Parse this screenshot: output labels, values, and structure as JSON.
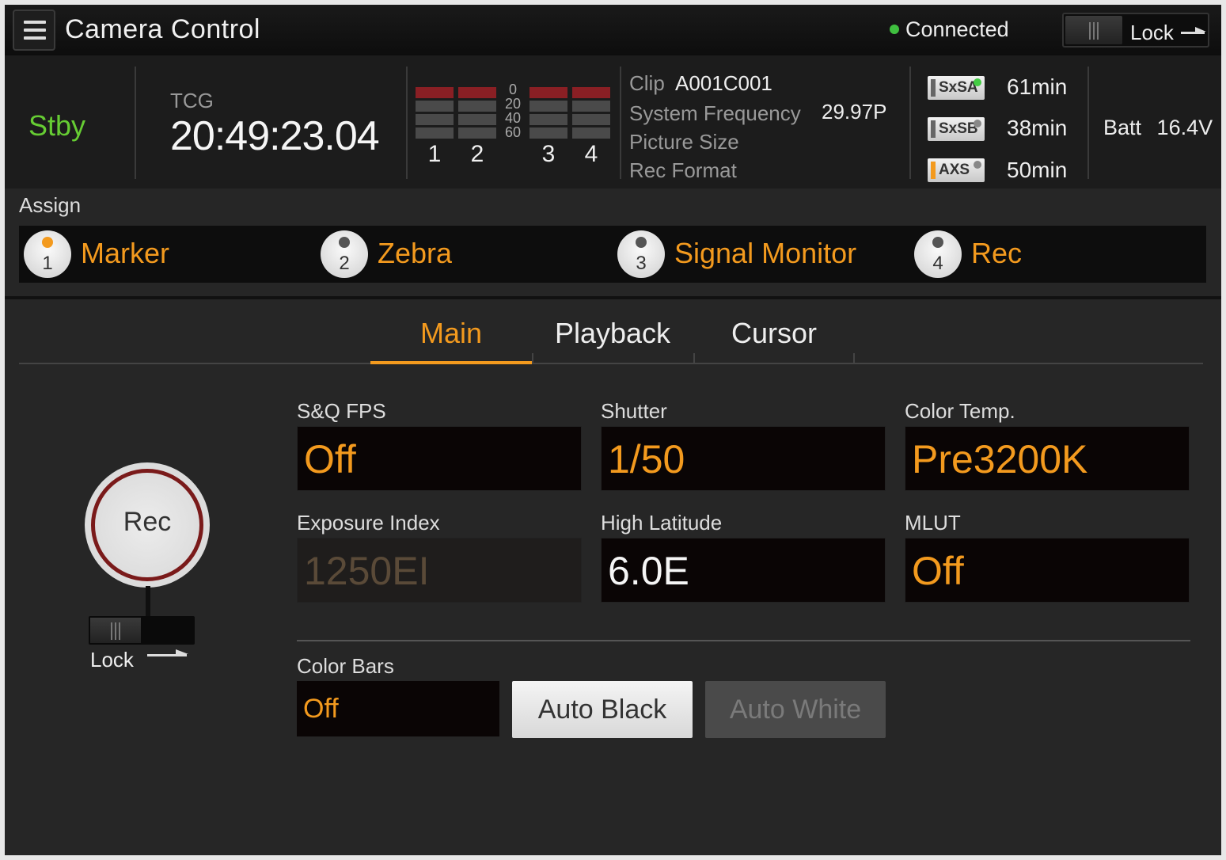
{
  "header": {
    "title": "Camera Control",
    "connection_status": "Connected",
    "lock_label": "Lock",
    "colors": {
      "connected": "#3fbf3f",
      "accent": "#f39a1e"
    }
  },
  "status": {
    "state": "Stby",
    "tcg_label": "TCG",
    "timecode": "20:49:23.04",
    "meter_scale": [
      "0",
      "20",
      "40",
      "60"
    ],
    "meter_channels": [
      "1",
      "2",
      "3",
      "4"
    ],
    "clip_label": "Clip",
    "clip_value": "A001C001",
    "system_frequency_label": "System Frequency",
    "system_frequency_value": "29.97P",
    "picture_size_label": "Picture Size",
    "rec_format_label": "Rec Format",
    "media": [
      {
        "name": "SxSA",
        "remaining": "61min",
        "icon": "sxs-a-media-icon"
      },
      {
        "name": "SxSB",
        "remaining": "38min",
        "icon": "sxs-b-media-icon"
      },
      {
        "name": "AXS",
        "remaining": "50min",
        "icon": "axs-media-icon"
      }
    ],
    "battery_label": "Batt",
    "battery_value": "16.4V"
  },
  "assign": {
    "label": "Assign",
    "items": [
      {
        "num": "1",
        "name": "Marker"
      },
      {
        "num": "2",
        "name": "Zebra"
      },
      {
        "num": "3",
        "name": "Signal Monitor"
      },
      {
        "num": "4",
        "name": "Rec"
      }
    ]
  },
  "tabs": [
    {
      "label": "Main",
      "active": true
    },
    {
      "label": "Playback",
      "active": false
    },
    {
      "label": "Cursor",
      "active": false
    }
  ],
  "rec": {
    "label": "Rec",
    "lock_label": "Lock"
  },
  "fields": {
    "sq_fps": {
      "label": "S&Q FPS",
      "value": "Off"
    },
    "shutter": {
      "label": "Shutter",
      "value": "1/50"
    },
    "color_temp": {
      "label": "Color Temp.",
      "value": "Pre3200K"
    },
    "exposure_index": {
      "label": "Exposure Index",
      "value": "1250EI"
    },
    "high_latitude": {
      "label": "High Latitude",
      "value": "6.0E"
    },
    "mlut": {
      "label": "MLUT",
      "value": "Off"
    },
    "color_bars": {
      "label": "Color Bars",
      "value": "Off"
    }
  },
  "buttons": {
    "auto_black": "Auto Black",
    "auto_white": "Auto White"
  }
}
